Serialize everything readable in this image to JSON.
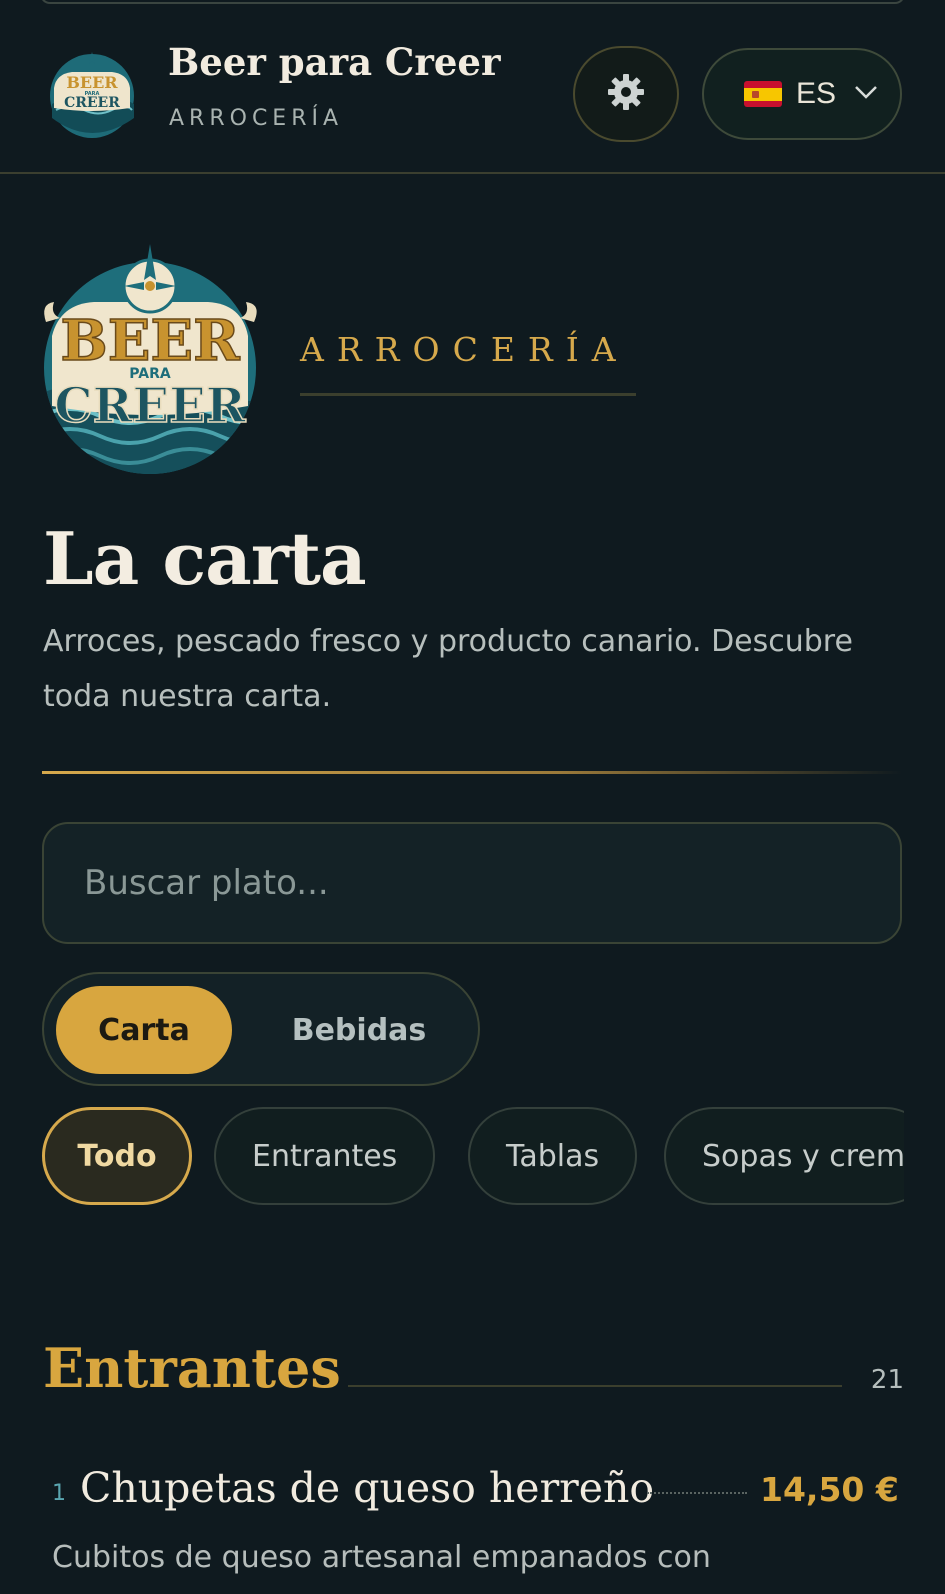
{
  "header": {
    "brand_name": "Beer para Creer",
    "brand_subtitle": "ARROCERÍA",
    "settings_icon": "gear-icon",
    "language": {
      "code": "ES",
      "flag": "spain-flag-icon"
    }
  },
  "logo": {
    "line1": "BEER",
    "line2": "PARA",
    "line3": "CREER"
  },
  "hero": {
    "tagline": "ARROCERÍA",
    "title": "La carta",
    "description": "Arroces, pescado fresco y producto canario. Descubre toda nuestra carta."
  },
  "search": {
    "placeholder": "Buscar plato...",
    "value": ""
  },
  "menu_toggle": {
    "active": "Carta",
    "inactive": "Bebidas"
  },
  "categories": [
    {
      "label": "Todo",
      "active": true
    },
    {
      "label": "Entrantes",
      "active": false
    },
    {
      "label": "Tablas",
      "active": false
    },
    {
      "label": "Sopas y crem",
      "active": false
    }
  ],
  "section": {
    "title": "Entrantes",
    "count": "21"
  },
  "dishes": [
    {
      "number": "1",
      "name": "Chupetas de queso herreño",
      "price": "14,50 €",
      "description": "Cubitos de queso artesanal empanados con"
    }
  ],
  "colors": {
    "background": "#0f1a1f",
    "accent_gold": "#d8a63f",
    "text_light": "#f1ebdf",
    "text_muted": "#b7bfbd"
  }
}
